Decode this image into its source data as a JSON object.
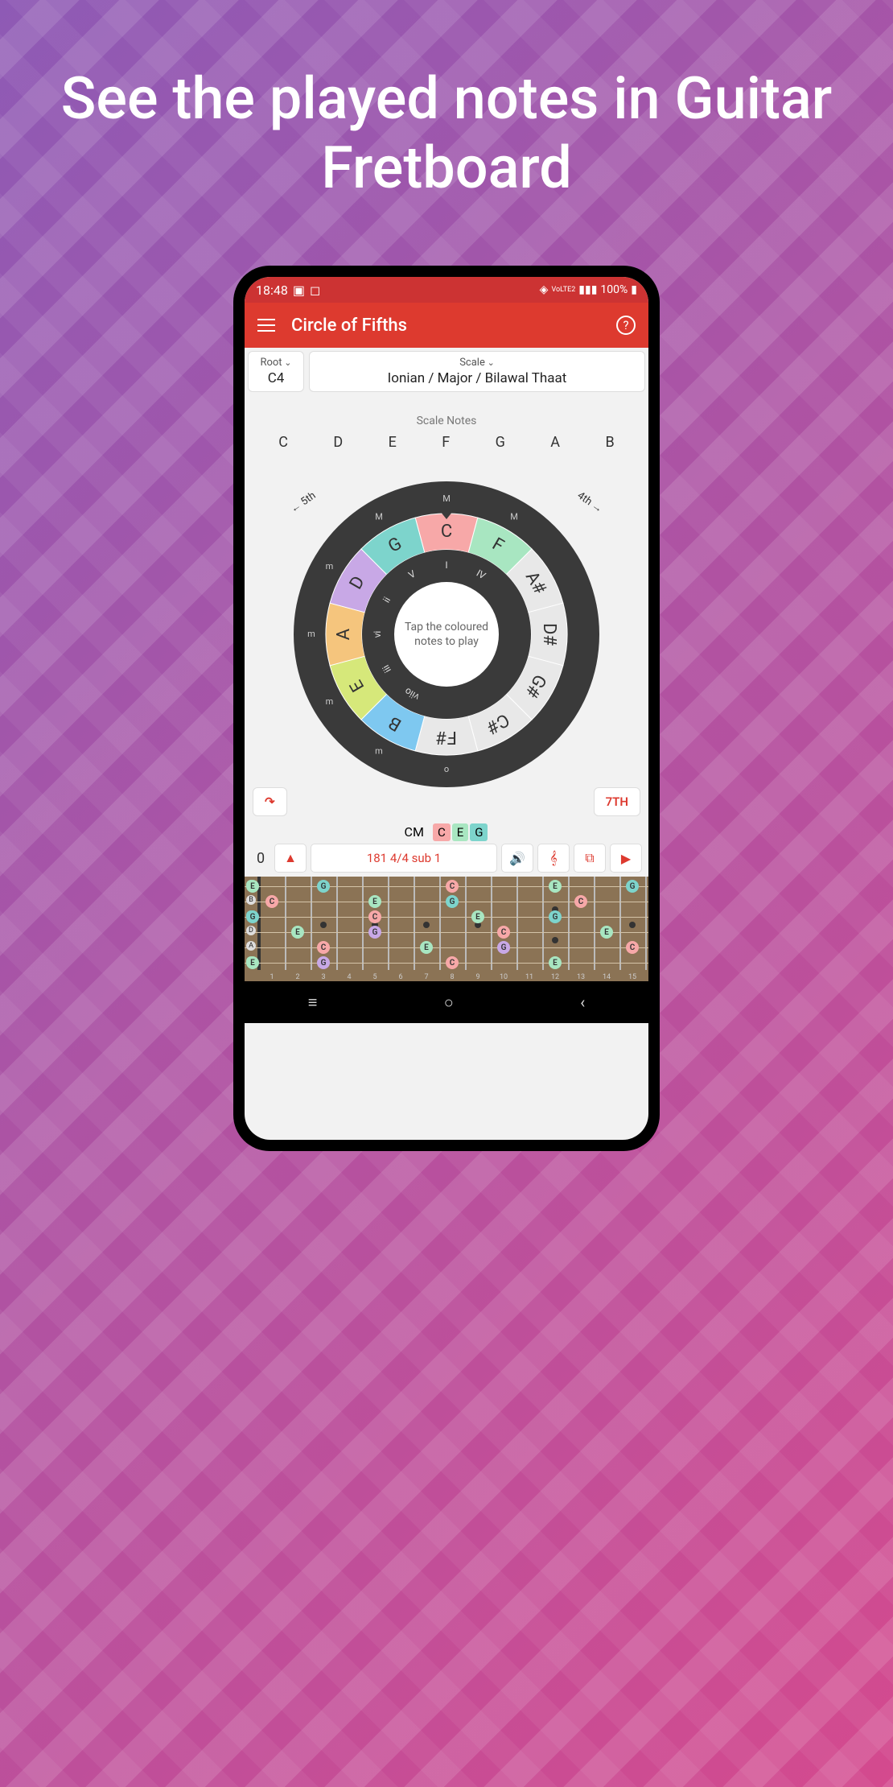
{
  "tagline": "See the played notes in Guitar Fretboard",
  "status": {
    "time": "18:48",
    "battery": "100%"
  },
  "app": {
    "title": "Circle of Fifths"
  },
  "selectors": {
    "root": {
      "label": "Root",
      "value": "C4"
    },
    "scale": {
      "label": "Scale",
      "value": "Ionian / Major / Bilawal Thaat"
    }
  },
  "scaleNotes": {
    "label": "Scale Notes",
    "notes": [
      "C",
      "D",
      "E",
      "F",
      "G",
      "A",
      "B"
    ]
  },
  "circle": {
    "centerText": "Tap the coloured notes to play",
    "arrow5th": "5th",
    "arrow4th": "4th",
    "segments": [
      {
        "note": "C",
        "color": "#f7a8a8",
        "quality": "M",
        "degree": "I"
      },
      {
        "note": "F",
        "color": "#a8e6c1",
        "quality": "M",
        "degree": "IV"
      },
      {
        "note": "A#",
        "color": "#e8e8e8",
        "quality": "",
        "degree": ""
      },
      {
        "note": "D#",
        "color": "#e8e8e8",
        "quality": "",
        "degree": ""
      },
      {
        "note": "G#",
        "color": "#e8e8e8",
        "quality": "",
        "degree": ""
      },
      {
        "note": "C#",
        "color": "#e8e8e8",
        "quality": "",
        "degree": ""
      },
      {
        "note": "F#",
        "color": "#e8e8e8",
        "quality": "o",
        "degree": ""
      },
      {
        "note": "B",
        "color": "#7ec8f0",
        "quality": "m",
        "degree": "viio"
      },
      {
        "note": "E",
        "color": "#d6e87a",
        "quality": "m",
        "degree": "iii"
      },
      {
        "note": "A",
        "color": "#f5c57d",
        "quality": "m",
        "degree": "vi"
      },
      {
        "note": "D",
        "color": "#c8a8e6",
        "quality": "m",
        "degree": "ii"
      },
      {
        "note": "G",
        "color": "#7dd4cc",
        "quality": "M",
        "degree": "V"
      }
    ]
  },
  "buttons": {
    "seventh": "7TH"
  },
  "chord": {
    "name": "CM",
    "notes": [
      {
        "n": "C",
        "c": "#f7a8a8"
      },
      {
        "n": "E",
        "c": "#a8e6c1"
      },
      {
        "n": "G",
        "c": "#7dd4cc"
      }
    ]
  },
  "controls": {
    "count": "0",
    "tempo": "181 4/4 sub 1"
  },
  "fretboard": {
    "strings": [
      "E",
      "B",
      "G",
      "D",
      "A",
      "E"
    ],
    "stringColors": [
      "#a8e6c1",
      "#ddd",
      "#7dd4cc",
      "#ddd",
      "#ddd",
      "#a8e6c1"
    ],
    "frets": 15,
    "dots": [
      3,
      5,
      7,
      9,
      12,
      15
    ],
    "notes": [
      {
        "s": 0,
        "f": 0,
        "n": "E",
        "c": "#a8e6c1"
      },
      {
        "s": 0,
        "f": 3,
        "n": "G",
        "c": "#7dd4cc"
      },
      {
        "s": 0,
        "f": 8,
        "n": "C",
        "c": "#f7a8a8"
      },
      {
        "s": 0,
        "f": 12,
        "n": "E",
        "c": "#a8e6c1"
      },
      {
        "s": 0,
        "f": 15,
        "n": "G",
        "c": "#7dd4cc"
      },
      {
        "s": 1,
        "f": 1,
        "n": "C",
        "c": "#f7a8a8"
      },
      {
        "s": 1,
        "f": 5,
        "n": "E",
        "c": "#a8e6c1"
      },
      {
        "s": 1,
        "f": 8,
        "n": "G",
        "c": "#7dd4cc"
      },
      {
        "s": 1,
        "f": 13,
        "n": "C",
        "c": "#f7a8a8"
      },
      {
        "s": 2,
        "f": 0,
        "n": "G",
        "c": "#7dd4cc"
      },
      {
        "s": 2,
        "f": 5,
        "n": "C",
        "c": "#f7a8a8"
      },
      {
        "s": 2,
        "f": 9,
        "n": "E",
        "c": "#a8e6c1"
      },
      {
        "s": 2,
        "f": 12,
        "n": "G",
        "c": "#7dd4cc"
      },
      {
        "s": 3,
        "f": 2,
        "n": "E",
        "c": "#a8e6c1"
      },
      {
        "s": 3,
        "f": 5,
        "n": "G",
        "c": "#c8a8e6"
      },
      {
        "s": 3,
        "f": 10,
        "n": "C",
        "c": "#f7a8a8"
      },
      {
        "s": 3,
        "f": 14,
        "n": "E",
        "c": "#a8e6c1"
      },
      {
        "s": 4,
        "f": 3,
        "n": "C",
        "c": "#f7a8a8"
      },
      {
        "s": 4,
        "f": 7,
        "n": "E",
        "c": "#a8e6c1"
      },
      {
        "s": 4,
        "f": 10,
        "n": "G",
        "c": "#c8a8e6"
      },
      {
        "s": 4,
        "f": 15,
        "n": "C",
        "c": "#f7a8a8"
      },
      {
        "s": 5,
        "f": 0,
        "n": "E",
        "c": "#a8e6c1"
      },
      {
        "s": 5,
        "f": 3,
        "n": "G",
        "c": "#c8a8e6"
      },
      {
        "s": 5,
        "f": 8,
        "n": "C",
        "c": "#f7a8a8"
      },
      {
        "s": 5,
        "f": 12,
        "n": "E",
        "c": "#a8e6c1"
      }
    ]
  }
}
